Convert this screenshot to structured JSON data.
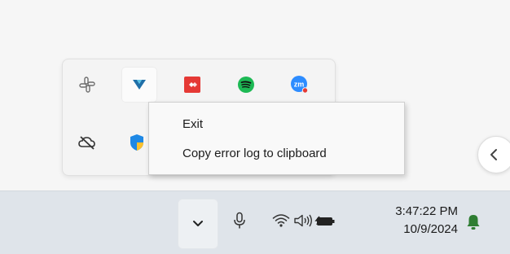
{
  "tray_overflow": {
    "icons": [
      {
        "name": "slack-icon"
      },
      {
        "name": "vpn-app-icon"
      },
      {
        "name": "anydesk-icon"
      },
      {
        "name": "spotify-icon"
      },
      {
        "name": "zoom-icon"
      },
      {
        "name": "onedrive-offline-icon"
      },
      {
        "name": "defender-icon"
      }
    ]
  },
  "context_menu": {
    "items": [
      {
        "label": "Exit"
      },
      {
        "label": "Copy error log to clipboard"
      }
    ]
  },
  "taskbar": {
    "time": "3:47:22 PM",
    "date": "10/9/2024"
  },
  "colors": {
    "anydesk": "#e53935",
    "spotify": "#1db954",
    "zoom": "#2d8cff",
    "notification": "#2e7d32"
  }
}
